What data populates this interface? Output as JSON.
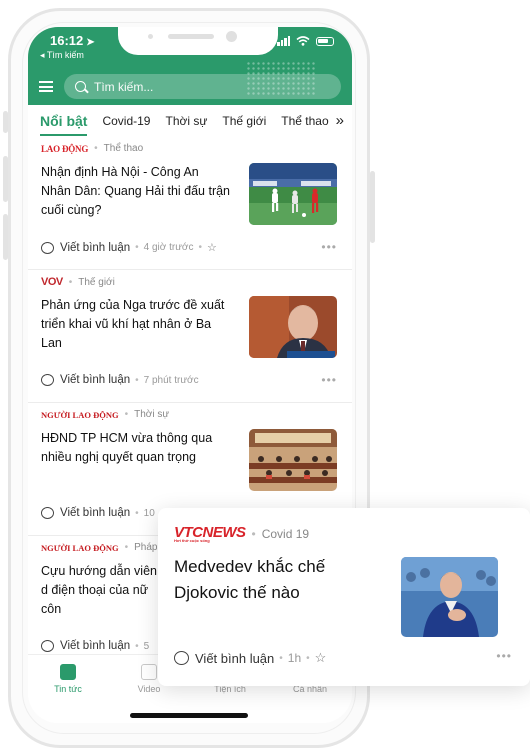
{
  "status_bar": {
    "time": "16:12",
    "back_label": "◂ Tìm kiếm"
  },
  "search": {
    "placeholder": "Tìm kiếm..."
  },
  "tabs": [
    {
      "label": "Nổi bật",
      "active": true
    },
    {
      "label": "Covid-19"
    },
    {
      "label": "Thời sự"
    },
    {
      "label": "Thế giới"
    },
    {
      "label": "Thể thao"
    }
  ],
  "tabs_more_icon": "double-chevron-right",
  "articles": [
    {
      "source": "LAO ĐỘNG",
      "category": "Thể thao",
      "title": "Nhận định Hà Nội - Công An Nhân Dân: Quang Hải thi đấu trận cuối cùng?",
      "comment_label": "Viết bình luận",
      "time_ago": "4 giờ trước"
    },
    {
      "source": "VOV",
      "category": "Thế giới",
      "title": "Phản ứng của Nga trước đề xuất triển khai vũ khí hạt nhân ở Ba Lan",
      "comment_label": "Viết bình luận",
      "time_ago": "7 phút trước"
    },
    {
      "source": "NGƯỜI LAO ĐỘNG",
      "category": "Thời sự",
      "title": "HĐND TP HCM vừa thông qua nhiều nghị quyết quan trọng",
      "comment_label": "Viết bình luận",
      "time_ago": "10"
    },
    {
      "source": "NGƯỜI LAO ĐỘNG",
      "category": "Pháp luật",
      "title": "Cựu hướng dẫn viên d điện thoại của nữ côn",
      "comment_label": "Viết bình luận",
      "time_ago": "5"
    }
  ],
  "popup_card": {
    "source": "VTCNEWS",
    "source_tagline": "Hơi thở cuộc sống",
    "category": "Covid 19",
    "title": "Medvedev khắc chế Djokovic thế nào",
    "comment_label": "Viết bình luận",
    "time_ago": "1h"
  },
  "bottom_nav": [
    {
      "label": "Tin tức",
      "icon": "news-icon",
      "active": true
    },
    {
      "label": "Video",
      "icon": "video-icon"
    },
    {
      "label": "Tiện ích",
      "icon": "utilities-icon"
    },
    {
      "label": "Cá nhân",
      "icon": "profile-icon"
    }
  ],
  "colors": {
    "accent": "#2b9a6b",
    "text": "#111111",
    "muted": "#999999"
  }
}
